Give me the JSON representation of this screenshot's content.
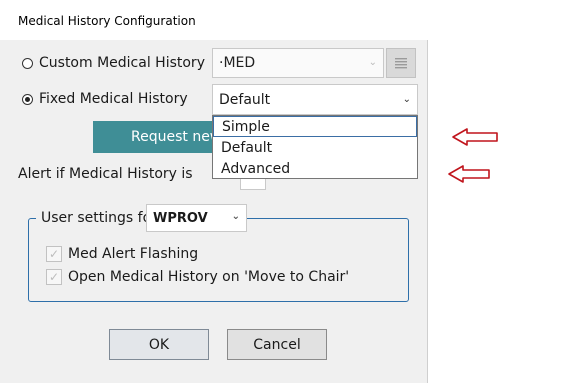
{
  "window": {
    "title": "Medical History Configuration"
  },
  "custom": {
    "label": "Custom Medical History",
    "selected": false,
    "value": "·MED"
  },
  "fixed": {
    "label": "Fixed Medical History",
    "selected": true,
    "value": "Default"
  },
  "request_button": {
    "label": "Request new Med"
  },
  "alert": {
    "label": "Alert if Medical History is"
  },
  "dropdown": {
    "options": [
      "Simple",
      "Default",
      "Advanced"
    ],
    "highlighted": "Simple"
  },
  "user_settings": {
    "label": "User settings for",
    "user": "WPROV",
    "options": [
      {
        "label": "Med Alert Flashing",
        "checked": true,
        "disabled": true
      },
      {
        "label": "Open Medical History on 'Move to Chair'",
        "checked": true,
        "disabled": true
      }
    ]
  },
  "buttons": {
    "ok": "OK",
    "cancel": "Cancel"
  },
  "colors": {
    "accent": "#3f8e96",
    "group_border": "#2e6fa9",
    "arrow": "#c0141c"
  },
  "icons": {
    "notes": "notes-icon",
    "chevron": "chevron-down-icon",
    "checkmark": "checkmark-icon",
    "arrow": "left-arrow-icon"
  }
}
